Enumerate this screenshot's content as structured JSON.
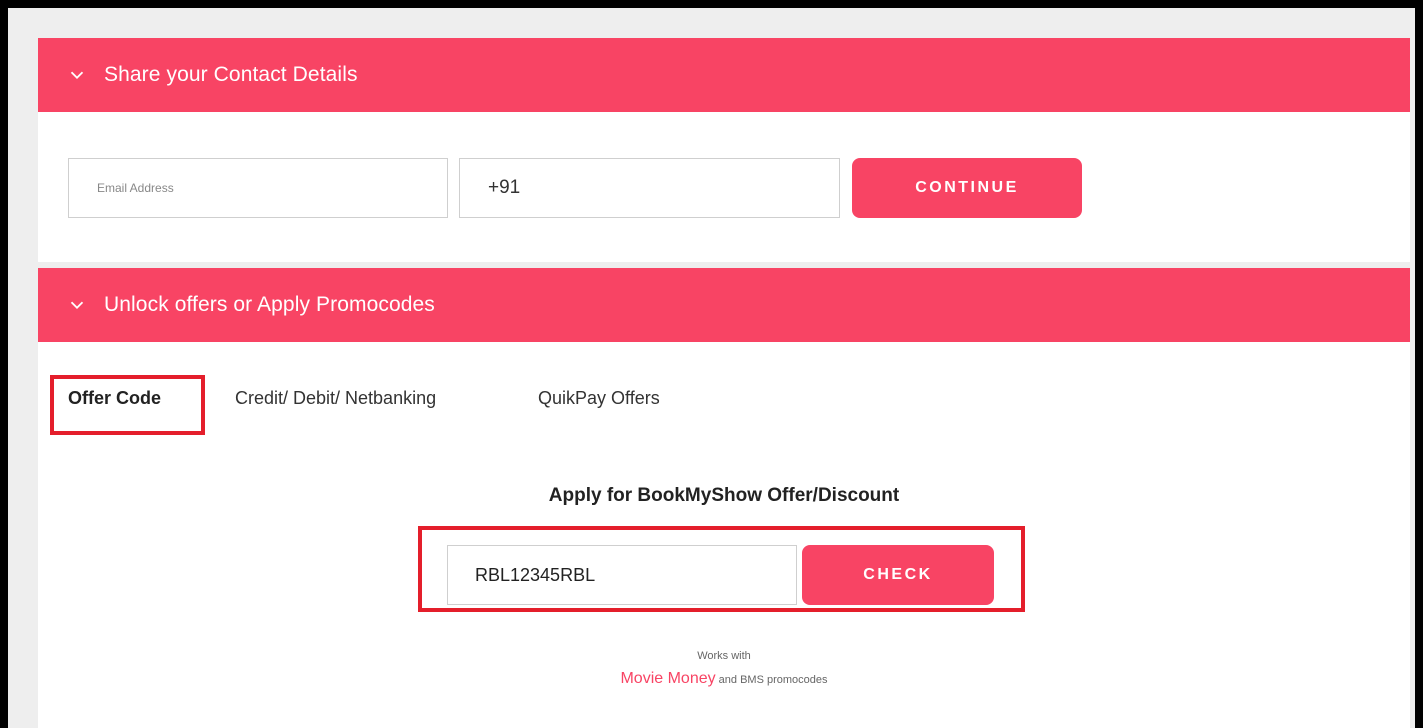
{
  "sections": {
    "contact": {
      "title": "Share your Contact Details",
      "email_placeholder": "Email Address",
      "phone_value": "+91",
      "continue_label": "CONTINUE"
    },
    "offers": {
      "title": "Unlock offers or Apply Promocodes",
      "tabs": [
        {
          "label": "Offer Code",
          "active": true
        },
        {
          "label": "Credit/ Debit/ Netbanking",
          "active": false
        },
        {
          "label": "QuikPay Offers",
          "active": false
        }
      ],
      "apply_heading": "Apply for BookMyShow Offer/Discount",
      "code_value": "RBL12345RBL",
      "check_label": "CHECK",
      "works_with": "Works with",
      "movie_money": "Movie Money",
      "works_suffix": " and BMS promocodes"
    }
  },
  "icons": {
    "section_toggle": "chevron-down-icon"
  },
  "colors": {
    "brand": "#f84464",
    "highlight": "#e41e2b"
  }
}
